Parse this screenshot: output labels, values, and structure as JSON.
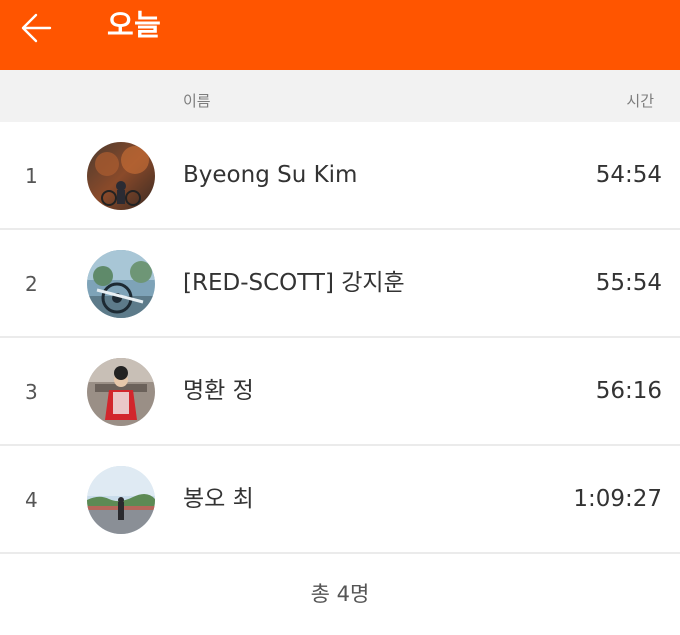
{
  "app_bar": {
    "title": "오늘",
    "icon": "arrow-left-icon",
    "background": "#ff5500"
  },
  "table_header": {
    "name_label": "이름",
    "time_label": "시간"
  },
  "leaderboard": [
    {
      "rank": "1",
      "name": "Byeong Su Kim",
      "time": "54:54"
    },
    {
      "rank": "2",
      "name": "[RED-SCOTT] 강지훈",
      "time": "55:54"
    },
    {
      "rank": "3",
      "name": "명환 정",
      "time": "56:16"
    },
    {
      "rank": "4",
      "name": "봉오 최",
      "time": "1:09:27"
    }
  ],
  "footer": {
    "total_label": "총 4명"
  }
}
